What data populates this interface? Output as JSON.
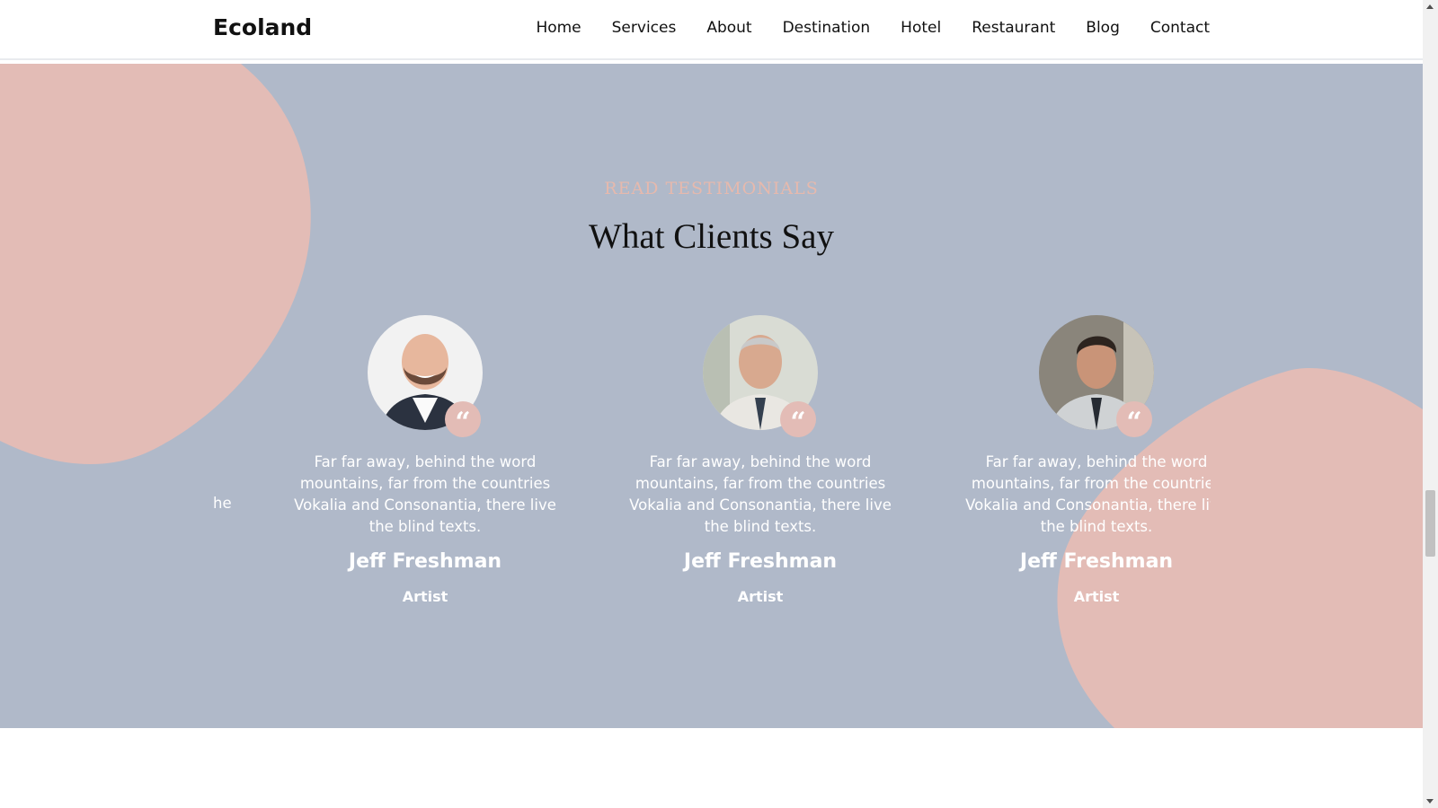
{
  "nav": {
    "brand": "Ecoland",
    "items": [
      {
        "label": "Home"
      },
      {
        "label": "Services"
      },
      {
        "label": "About"
      },
      {
        "label": "Destination"
      },
      {
        "label": "Hotel"
      },
      {
        "label": "Restaurant"
      },
      {
        "label": "Blog"
      },
      {
        "label": "Contact"
      }
    ]
  },
  "testimonials": {
    "subheading": "READ TESTIMONIALS",
    "heading": "What Clients Say",
    "partial_prev_text": "he",
    "cards": [
      {
        "quote": "Far far away, behind the word mountains, far from the countries Vokalia and Consonantia, there live the blind texts.",
        "name": "Jeff Freshman",
        "role": "Artist",
        "quote_icon": "quote-icon"
      },
      {
        "quote": "Far far away, behind the word mountains, far from the countries Vokalia and Consonantia, there live the blind texts.",
        "name": "Jeff Freshman",
        "role": "Artist",
        "quote_icon": "quote-icon"
      },
      {
        "quote": "Far far away, behind the word mountains, far from the countries Vokalia and Consonantia, there live the blind texts.",
        "name": "Jeff Freshman",
        "role": "Artist",
        "quote_icon": "quote-icon"
      }
    ]
  },
  "colors": {
    "section_bg": "#b0b9c9",
    "blob": "#e3bcb6",
    "accent": "#e6b9ad"
  }
}
